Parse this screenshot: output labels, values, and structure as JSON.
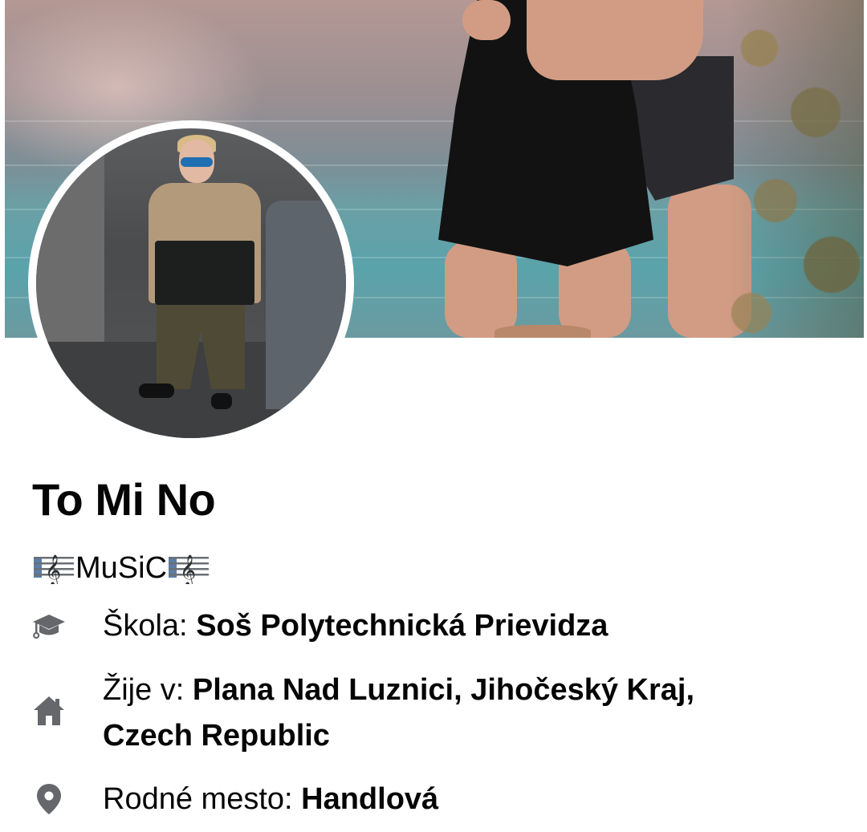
{
  "profile": {
    "name": "To Mi No",
    "bio_text": "MuSiC",
    "bio_icon": "musical-score-icon"
  },
  "details": {
    "school": {
      "icon": "graduation-cap-icon",
      "label": "Škola:",
      "value": "Soš Polytechnická Prievidza"
    },
    "lives": {
      "icon": "home-icon",
      "label": "Žije v:",
      "value_line1": "Plana Nad Luznici, Jihočeský Kraj,",
      "value_line2": "Czech Republic"
    },
    "hometown": {
      "icon": "location-pin-icon",
      "label": "Rodné mesto:",
      "value": "Handlová"
    }
  },
  "colors": {
    "icon_gray": "#65676b",
    "text": "#050505",
    "background": "#ffffff"
  }
}
